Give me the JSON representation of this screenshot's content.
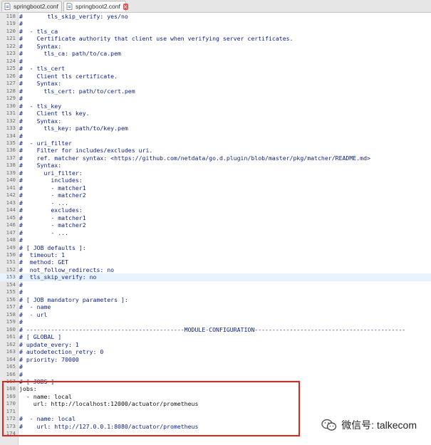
{
  "tabs": [
    {
      "label": "springboot2.conf",
      "active": false
    },
    {
      "label": "springboot2.conf",
      "active": true
    }
  ],
  "colors": {
    "comment_code": "#0a1f86",
    "plain_code": "#101010",
    "highlight_line": "#e8f2fe",
    "annotation_box": "#e2231a"
  },
  "editor": {
    "highlighted_line": "153",
    "lines": [
      {
        "num": "118",
        "text": "#       tls_skip_verify: yes/no"
      },
      {
        "num": "119",
        "text": "#"
      },
      {
        "num": "120",
        "text": "#  - tls_ca"
      },
      {
        "num": "121",
        "text": "#    Certificate authority that client use when verifying server certificates."
      },
      {
        "num": "122",
        "text": "#    Syntax:"
      },
      {
        "num": "123",
        "text": "#      tls_ca: path/to/ca.pem"
      },
      {
        "num": "124",
        "text": "#"
      },
      {
        "num": "125",
        "text": "#  - tls_cert"
      },
      {
        "num": "126",
        "text": "#    Client tls certificate."
      },
      {
        "num": "127",
        "text": "#    Syntax:"
      },
      {
        "num": "128",
        "text": "#      tls_cert: path/to/cert.pem"
      },
      {
        "num": "129",
        "text": "#"
      },
      {
        "num": "130",
        "text": "#  - tls_key"
      },
      {
        "num": "131",
        "text": "#    Client tls key."
      },
      {
        "num": "132",
        "text": "#    Syntax:"
      },
      {
        "num": "133",
        "text": "#      tls_key: path/to/key.pem"
      },
      {
        "num": "134",
        "text": "#"
      },
      {
        "num": "135",
        "text": "#  - uri_filter"
      },
      {
        "num": "136",
        "text": "#    Filter for includes/excludes uri."
      },
      {
        "num": "137",
        "text": "#    ref. matcher syntax: <https://github.com/netdata/go.d.plugin/blob/master/pkg/matcher/README.md>"
      },
      {
        "num": "138",
        "text": "#    Syntax:"
      },
      {
        "num": "139",
        "text": "#      uri_filter:"
      },
      {
        "num": "140",
        "text": "#        includes:"
      },
      {
        "num": "141",
        "text": "#        - matcher1"
      },
      {
        "num": "142",
        "text": "#        - matcher2"
      },
      {
        "num": "143",
        "text": "#        - ..."
      },
      {
        "num": "144",
        "text": "#        excludes:"
      },
      {
        "num": "145",
        "text": "#        - matcher1"
      },
      {
        "num": "146",
        "text": "#        - matcher2"
      },
      {
        "num": "147",
        "text": "#        - ..."
      },
      {
        "num": "148",
        "text": "#"
      },
      {
        "num": "149",
        "text": "# [ JOB defaults ]:"
      },
      {
        "num": "150",
        "text": "#  timeout: 1"
      },
      {
        "num": "151",
        "text": "#  method: GET"
      },
      {
        "num": "152",
        "text": "#  not_follow_redirects: no"
      },
      {
        "num": "153",
        "text": "#  tls_skip_verify: no"
      },
      {
        "num": "154",
        "text": "#"
      },
      {
        "num": "155",
        "text": "#"
      },
      {
        "num": "156",
        "text": "# [ JOB mandatory parameters ]:"
      },
      {
        "num": "157",
        "text": "#  - name"
      },
      {
        "num": "158",
        "text": "#  - url"
      },
      {
        "num": "159",
        "text": "#"
      },
      {
        "num": "160",
        "text": "# ---------------------------------------------MODULE-CONFIGURATION-------------------------------------------"
      },
      {
        "num": "161",
        "text": "# [ GLOBAL ]"
      },
      {
        "num": "162",
        "text": "# update_every: 1"
      },
      {
        "num": "163",
        "text": "# autodetection_retry: 0"
      },
      {
        "num": "164",
        "text": "# priority: 70000"
      },
      {
        "num": "165",
        "text": "#"
      },
      {
        "num": "166",
        "text": "#"
      },
      {
        "num": "167",
        "text": "# [ JOBS ]"
      },
      {
        "num": "168",
        "text": "jobs:",
        "plain": true
      },
      {
        "num": "169",
        "text": "  - name: local",
        "plain": true
      },
      {
        "num": "170",
        "text": "    url: http://localhost:12000/actuator/prometheus",
        "plain": true
      },
      {
        "num": "171",
        "text": ""
      },
      {
        "num": "172",
        "text": "#  - name: local"
      },
      {
        "num": "173",
        "text": "#    url: http://127.0.0.1:8080/actuator/prometheus"
      },
      {
        "num": "174",
        "text": ""
      }
    ]
  },
  "watermark": {
    "text": "微信号: talkecom"
  }
}
